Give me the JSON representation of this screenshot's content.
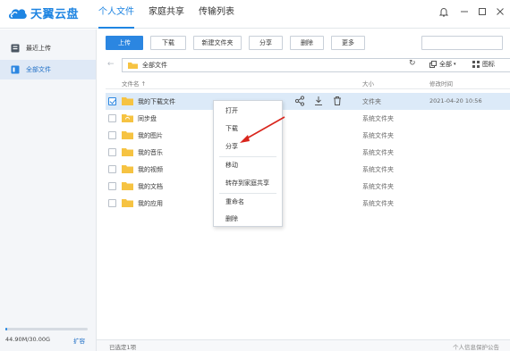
{
  "app": {
    "logo_text": "天翼云盘"
  },
  "nav": {
    "tabs": [
      "个人文件",
      "家庭共享",
      "传输列表"
    ]
  },
  "sidebar": {
    "items": [
      {
        "label": "最近上传"
      },
      {
        "label": "全部文件"
      }
    ],
    "quota_text": "44.90M/30.00G",
    "quota_fraction": 0.0015,
    "expand_label": "扩容"
  },
  "toolbar": {
    "upload": "上传",
    "download": "下载",
    "new_folder": "新建文件夹",
    "share": "分享",
    "delete": "删除",
    "more": "更多"
  },
  "path": {
    "current": "全部文件"
  },
  "view": {
    "copy_label": "全部",
    "icon_label": "图标"
  },
  "table": {
    "headers": {
      "name": "文件名 ↑",
      "size": "大小",
      "modified": "修改时间"
    },
    "rows": [
      {
        "name": "我的下载文件",
        "type": "文件夹",
        "date": "2021-04-20 10:56",
        "checked": true
      },
      {
        "name": "同步盘",
        "type": "系统文件夹",
        "date": ""
      },
      {
        "name": "我的图片",
        "type": "系统文件夹",
        "date": ""
      },
      {
        "name": "我的音乐",
        "type": "系统文件夹",
        "date": ""
      },
      {
        "name": "我的视频",
        "type": "系统文件夹",
        "date": ""
      },
      {
        "name": "我的文档",
        "type": "系统文件夹",
        "date": ""
      },
      {
        "name": "我的应用",
        "type": "系统文件夹",
        "date": ""
      }
    ]
  },
  "context_menu": {
    "open": "打开",
    "download": "下载",
    "share": "分享",
    "move": "移动",
    "save_to_family": "转存到家庭共享",
    "rename": "重命名",
    "delete": "删除"
  },
  "status": {
    "selected": "已选定1项",
    "privacy": "个人信息保护公告"
  },
  "colors": {
    "accent": "#2b86e1",
    "folder": "#f6c342",
    "annotation_arrow": "#d9251c"
  }
}
